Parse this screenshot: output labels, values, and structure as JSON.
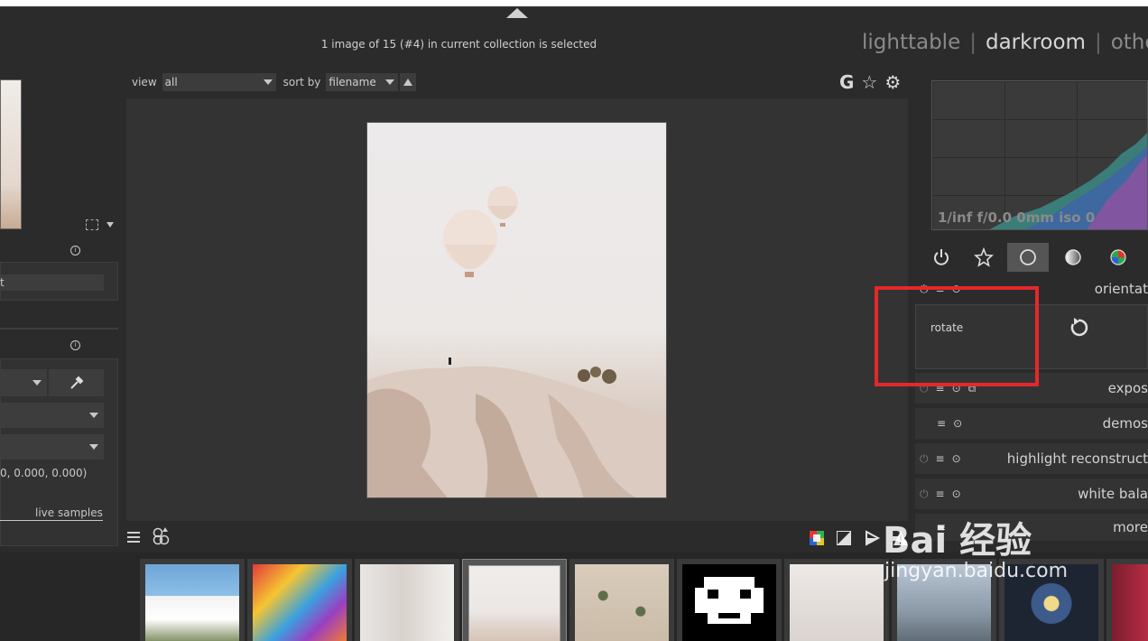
{
  "status": {
    "text": "1 image of 15 (#4) in current collection is selected"
  },
  "views": {
    "lighttable": "lighttable",
    "sep": "|",
    "darkroom": "darkroom",
    "other": "othe"
  },
  "filter": {
    "view_label": "view",
    "view_value": "all",
    "sort_label": "sort by",
    "sort_value": "filename"
  },
  "top_icons": {
    "g": "G",
    "star": "☆",
    "gear": "⚙"
  },
  "left_panel": {
    "field1": "t",
    "color_values": "0, 0.000, 0.000)",
    "live_samples": "live samples"
  },
  "histogram": {
    "exif": "1/inf f/0.0 0mm iso 0"
  },
  "modules": [
    {
      "name": "orientat"
    },
    {
      "name": "expos"
    },
    {
      "name": "demos"
    },
    {
      "name": "highlight reconstruct"
    },
    {
      "name": "white bala"
    },
    {
      "name": "more"
    }
  ],
  "rotate": {
    "label": "rotate"
  },
  "watermark": {
    "brand": "Bai  经验",
    "url": "jingyan.baidu.com"
  },
  "colors": {
    "highlight": "#e4282b",
    "bg": "#2b2b2b"
  }
}
